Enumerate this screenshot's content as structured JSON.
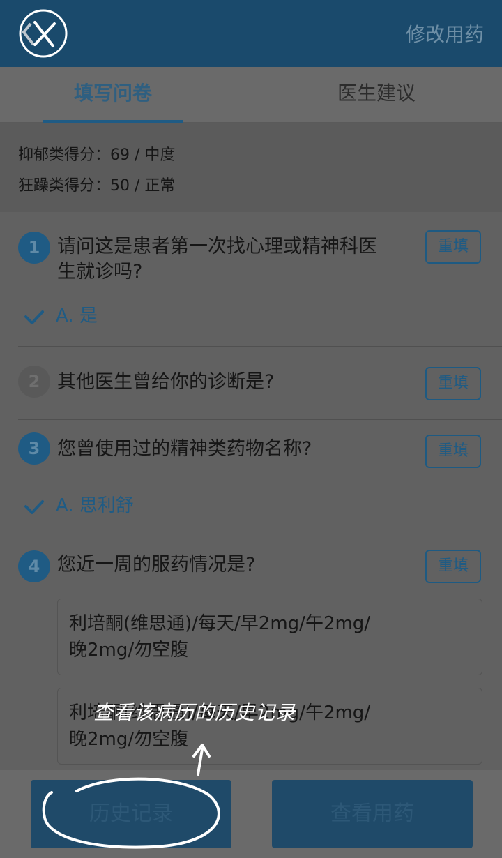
{
  "header": {
    "right_action": "修改用药"
  },
  "tabs": [
    {
      "label": "填写问卷"
    },
    {
      "label": "医生建议"
    }
  ],
  "scores": {
    "line1": "抑郁类得分：69 / 中度",
    "line2": "狂躁类得分：50 / 正常"
  },
  "questions": [
    {
      "num": "1",
      "text_line1": "请问这是患者第一次找心理或精神科医",
      "text_line2": "生就诊吗?",
      "reset": "重填",
      "answer": "A. 是"
    },
    {
      "num": "2",
      "text_line1": "其他医生曾给你的诊断是?",
      "reset": "重填"
    },
    {
      "num": "3",
      "text_line1": "您曾使用过的精神类药物名称?",
      "reset": "重填",
      "answer": "A. 思利舒"
    },
    {
      "num": "4",
      "text_line1": "您近一周的服药情况是?",
      "reset": "重填"
    }
  ],
  "medications": [
    {
      "line1": "利培酮(维思通)/每天/早2mg/午2mg/",
      "line2": "晚2mg/勿空腹"
    },
    {
      "line1": "利培酮(维思通)/每天/早2mg/午2mg/",
      "line2": "晚2mg/勿空腹"
    }
  ],
  "bottom": {
    "history": "历史记录",
    "view_meds": "查看用药"
  },
  "annotation": {
    "text": "查看该病历的历史记录"
  },
  "colors": {
    "header": "#1a4a6c",
    "accent": "#1f5b84",
    "overlay_bg": "#616161"
  }
}
